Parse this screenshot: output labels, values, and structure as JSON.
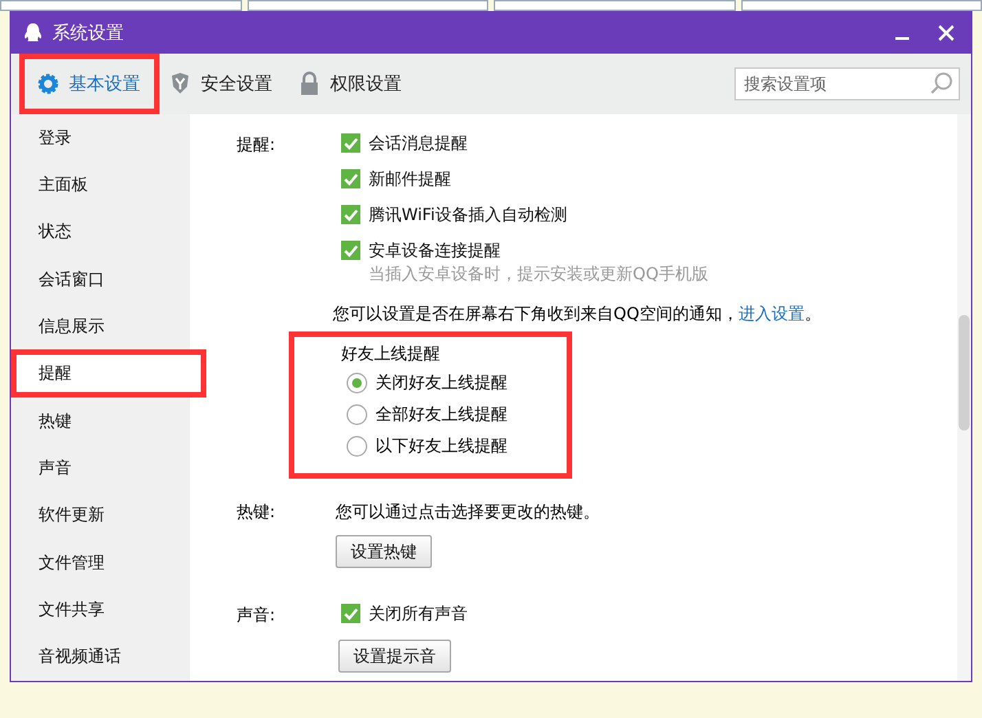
{
  "window": {
    "title": "系统设置"
  },
  "tabs": [
    {
      "label": "基本设置",
      "kind": "gear",
      "selected": true,
      "highlighted": true
    },
    {
      "label": "安全设置",
      "kind": "shield",
      "selected": false,
      "highlighted": false
    },
    {
      "label": "权限设置",
      "kind": "lock",
      "selected": false,
      "highlighted": false
    }
  ],
  "search": {
    "placeholder": "搜索设置项"
  },
  "sidebar": {
    "items": [
      {
        "label": "登录",
        "selected": false,
        "highlighted": false
      },
      {
        "label": "主面板",
        "selected": false,
        "highlighted": false
      },
      {
        "label": "状态",
        "selected": false,
        "highlighted": false
      },
      {
        "label": "会话窗口",
        "selected": false,
        "highlighted": false
      },
      {
        "label": "信息展示",
        "selected": false,
        "highlighted": false
      },
      {
        "label": "提醒",
        "selected": true,
        "highlighted": true
      },
      {
        "label": "热键",
        "selected": false,
        "highlighted": false
      },
      {
        "label": "声音",
        "selected": false,
        "highlighted": false
      },
      {
        "label": "软件更新",
        "selected": false,
        "highlighted": false
      },
      {
        "label": "文件管理",
        "selected": false,
        "highlighted": false
      },
      {
        "label": "文件共享",
        "selected": false,
        "highlighted": false
      },
      {
        "label": "音视频通话",
        "selected": false,
        "highlighted": false
      }
    ]
  },
  "reminders": {
    "label": "提醒:",
    "checkboxes": [
      {
        "label": "会话消息提醒",
        "checked": true
      },
      {
        "label": "新邮件提醒",
        "checked": true
      },
      {
        "label": "腾讯WiFi设备插入自动检测",
        "checked": true
      },
      {
        "label": "安卓设备连接提醒",
        "checked": true
      }
    ],
    "android_note": "当插入安卓设备时，提示安装或更新QQ手机版",
    "qzone_notice": {
      "text": "您可以设置是否在屏幕右下角收到来自QQ空间的通知，",
      "link": "进入设置",
      "end": "。"
    },
    "friend_online": {
      "title": "好友上线提醒",
      "highlighted": true,
      "options": [
        {
          "label": "关闭好友上线提醒",
          "selected": true
        },
        {
          "label": "全部好友上线提醒",
          "selected": false
        },
        {
          "label": "以下好友上线提醒",
          "selected": false
        }
      ]
    }
  },
  "hotkeys": {
    "label": "热键:",
    "text": "您可以通过点击选择要更改的热键。",
    "button": "设置热键"
  },
  "sound": {
    "label": "声音:",
    "checkbox": {
      "label": "关闭所有声音",
      "checked": true
    },
    "button": "设置提示音"
  }
}
